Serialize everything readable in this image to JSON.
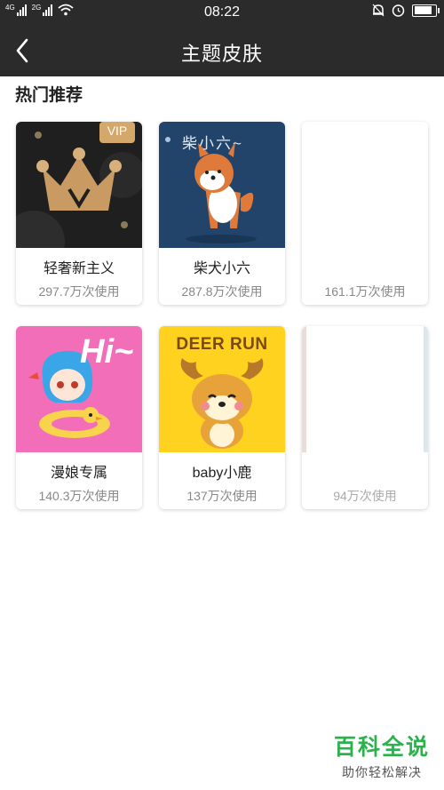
{
  "status_bar": {
    "time": "08:22",
    "net1": "4G",
    "net2": "2G",
    "icons": [
      "signal-icon",
      "signal-icon",
      "wifi-icon",
      "alarm-bell-icon",
      "clock-icon",
      "battery-icon"
    ],
    "battery_level": 0.95
  },
  "header": {
    "title": "主题皮肤",
    "back_icon": "back-chevron-icon",
    "background": "#2b2b2b"
  },
  "section": {
    "heading": "热门推荐"
  },
  "themes": [
    {
      "name": "轻奢新主义",
      "uses": "297.7万次使用",
      "badge": "VIP"
    },
    {
      "name": "柴犬小六",
      "uses": "287.8万次使用",
      "art_text": "柴小六~"
    },
    {
      "name": "",
      "uses": "161.1万次使用"
    },
    {
      "name": "漫娘专属",
      "uses": "140.3万次使用",
      "art_text": "Hi~"
    },
    {
      "name": "baby小鹿",
      "uses": "137万次使用",
      "art_text": "DEER RUN"
    },
    {
      "name": "",
      "uses": "94万次使用"
    }
  ],
  "watermark": {
    "title": "百科全说",
    "subtitle": "助你轻松解决"
  },
  "colors": {
    "accent_green": "#2bb24c",
    "vip_gold": "#d4a86a"
  }
}
